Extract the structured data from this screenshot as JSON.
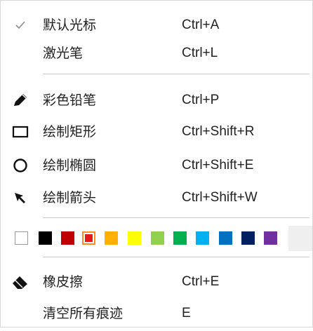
{
  "menu": {
    "items": [
      {
        "label": "默认光标",
        "shortcut": "Ctrl+A",
        "icon": "checkmark-icon"
      },
      {
        "label": "激光笔",
        "shortcut": "Ctrl+L",
        "icon": ""
      },
      {
        "label": "彩色铅笔",
        "shortcut": "Ctrl+P",
        "icon": "pencil-icon"
      },
      {
        "label": "绘制矩形",
        "shortcut": "Ctrl+Shift+R",
        "icon": "rectangle-icon"
      },
      {
        "label": "绘制椭圆",
        "shortcut": "Ctrl+Shift+E",
        "icon": "ellipse-icon"
      },
      {
        "label": "绘制箭头",
        "shortcut": "Ctrl+Shift+W",
        "icon": "arrow-icon"
      },
      {
        "label": "橡皮擦",
        "shortcut": "Ctrl+E",
        "icon": "eraser-icon"
      },
      {
        "label": "清空所有痕迹",
        "shortcut": "E",
        "icon": ""
      }
    ],
    "palette": {
      "colors": [
        "#ffffff",
        "#000000",
        "#c00000",
        "#e21b1b",
        "#ffb000",
        "#ffff00",
        "#92d050",
        "#00b050",
        "#00b0f0",
        "#0070c0",
        "#002060",
        "#7030a0"
      ],
      "selected_color": "#e21b1b"
    }
  }
}
